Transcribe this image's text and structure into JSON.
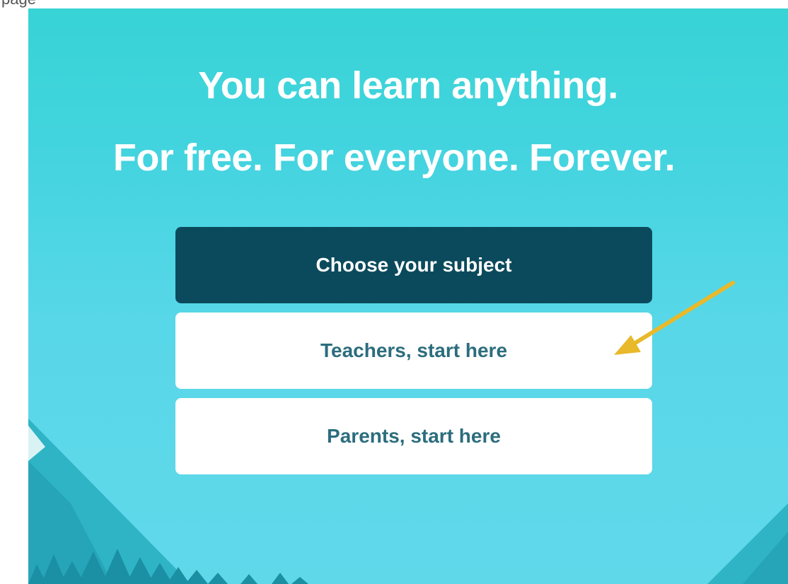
{
  "top_strip": {
    "text": "page"
  },
  "hero": {
    "headline_line1": "You can learn anything.",
    "headline_line2": "For free. For everyone. Forever."
  },
  "buttons": {
    "choose_subject": "Choose your subject",
    "teachers": "Teachers, start here",
    "parents": "Parents, start here"
  },
  "colors": {
    "hero_background": "#43d4df",
    "primary_button": "#0b4a5c",
    "secondary_button_text": "#2c6d7d",
    "annotation_arrow": "#e8b92a"
  },
  "icons": {
    "annotation": "arrow-annotation-icon",
    "decoration": "mountain-illustration"
  }
}
